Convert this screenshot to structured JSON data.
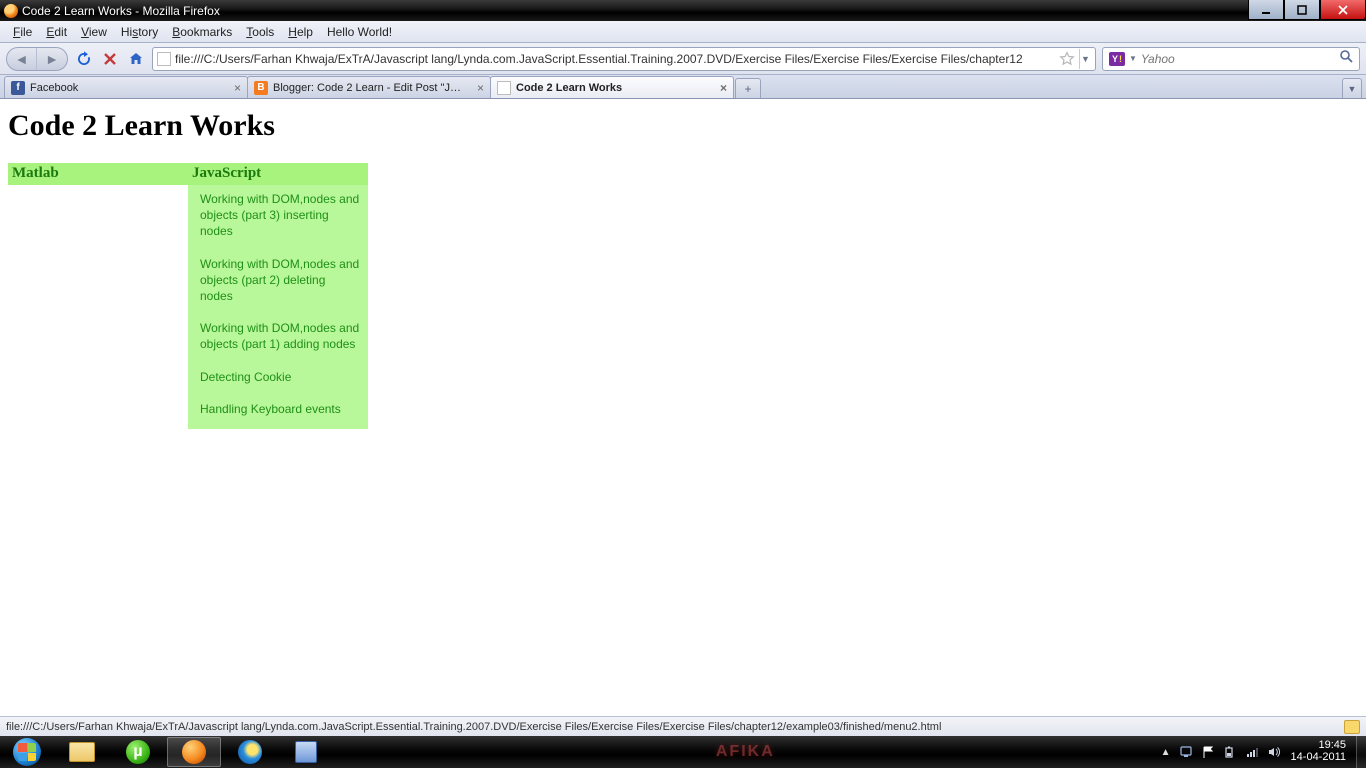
{
  "window": {
    "title": "Code 2 Learn Works - Mozilla Firefox"
  },
  "menu": {
    "items": [
      "File",
      "Edit",
      "View",
      "History",
      "Bookmarks",
      "Tools",
      "Help",
      "Hello World!"
    ]
  },
  "nav": {
    "url": "file:///C:/Users/Farhan Khwaja/ExTrA/Javascript lang/Lynda.com.JavaScript.Essential.Training.2007.DVD/Exercise Files/Exercise Files/Exercise Files/chapter12",
    "search_engine_label": "Y",
    "search_placeholder": "Yahoo"
  },
  "tabs": [
    {
      "label": "Facebook",
      "fav": "fb",
      "active": false
    },
    {
      "label": "Blogger: Code 2 Learn - Edit Post \"J…",
      "fav": "bl",
      "active": false
    },
    {
      "label": "Code 2 Learn Works",
      "fav": "pg",
      "active": true
    }
  ],
  "page": {
    "heading": "Code 2 Learn Works",
    "columns": [
      {
        "title": "Matlab",
        "expanded": false,
        "items": []
      },
      {
        "title": "JavaScript",
        "expanded": true,
        "items": [
          "Working with DOM,nodes and objects (part 3) inserting nodes",
          "Working with DOM,nodes and objects (part 2) deleting nodes",
          "Working with DOM,nodes and objects (part 1) adding nodes",
          "Detecting Cookie",
          "Handling Keyboard events"
        ]
      }
    ]
  },
  "status": {
    "text": "file:///C:/Users/Farhan Khwaja/ExTrA/Javascript lang/Lynda.com.JavaScript.Essential.Training.2007.DVD/Exercise Files/Exercise Files/Exercise Files/chapter12/example03/finished/menu2.html"
  },
  "taskbar": {
    "center_text": "AFIKA",
    "time": "19:45",
    "date": "14-04-2011"
  }
}
